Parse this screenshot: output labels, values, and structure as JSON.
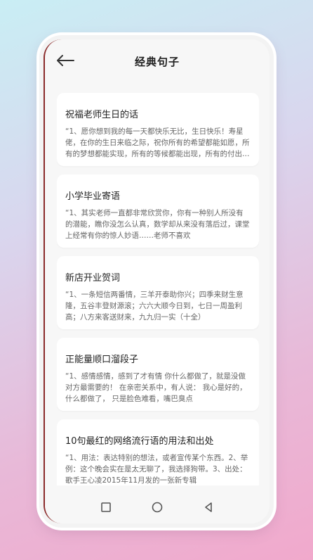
{
  "header": {
    "title": "经典句子"
  },
  "items": [
    {
      "title": "祝福老师生日的话",
      "text": "“1、愿你想到我的每一天都快乐无比，生日快乐！寿星佬，在你的生日来临之际，祝你所有的希望都能如愿，所有的梦想都能实现，所有的等候都能出现，所有的付出都能兑现。"
    },
    {
      "title": "小学毕业寄语",
      "text": "“1、其实老师一直都非常欣赏你，你有一种别人所没有的潜能，瞧你没怎么认真，数学却从来没有落后过，课堂上经常有你的惊人妙语……老师不喜欢"
    },
    {
      "title": "新店开业贺词",
      "text": "“1、一条短信两番情，三羊开泰助你兴；四季来财生意隆，五谷丰登财源滚；六六大顺今日到，七日一周盈利高；八方来客送财来，九九归一实（十全）"
    },
    {
      "title": "正能量顺口溜段子",
      "text": "“1、感情感情，感到了才有情 你什么都做了，就是没做对方最需要的！ 在亲密关系中，有人说： 我心是好的，什么都做了， 只是脸色难看，嘴巴臭点"
    },
    {
      "title": "10句最红的网络流行语的用法和出处",
      "text": "“1、用法：表达特别的想法，或者宣传某个东西。2、举例：这个晚会实在是太无聊了，我选择狗带。3、出处：歌手王心凌2015年11月发的一张新专辑"
    }
  ]
}
